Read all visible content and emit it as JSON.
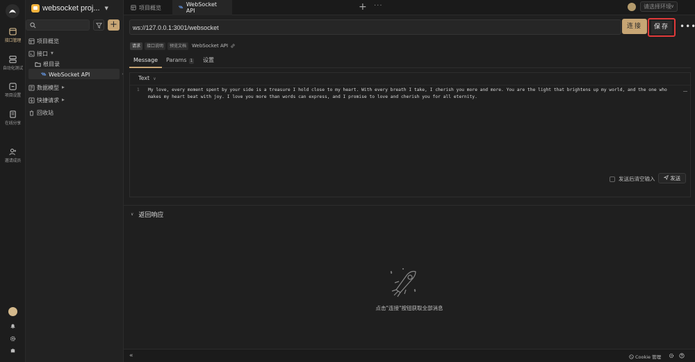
{
  "rail": {
    "items": [
      {
        "label": "接口管理",
        "icon": "api-management-icon",
        "active": true
      },
      {
        "label": "自动化测试",
        "icon": "automation-test-icon"
      },
      {
        "label": "项目设置",
        "icon": "project-settings-icon"
      },
      {
        "label": "在线分享",
        "icon": "online-share-icon"
      },
      {
        "label": "邀请成员",
        "icon": "invite-member-icon"
      }
    ]
  },
  "project": {
    "name": "websocket proj..."
  },
  "search": {
    "value": "",
    "placeholder": ""
  },
  "tree": {
    "items": [
      {
        "label": "项目概览",
        "icon": "overview-icon"
      },
      {
        "label": "接口",
        "icon": "api-folder-icon"
      },
      {
        "label": "根目录",
        "icon": "folder-icon"
      },
      {
        "label": "WebSocket API",
        "icon": "websocket-icon",
        "selected": true
      },
      {
        "label": "数据模型",
        "icon": "data-model-icon"
      },
      {
        "label": "快捷请求",
        "icon": "quick-request-icon"
      },
      {
        "label": "回收站",
        "icon": "trash-icon"
      }
    ]
  },
  "tabs": [
    {
      "label": "项目概览",
      "icon": "overview-icon"
    },
    {
      "label": "WebSocket API",
      "icon": "websocket-icon",
      "active": true
    }
  ],
  "env": {
    "placeholder": "请选择环境"
  },
  "url": {
    "value": "ws://127.0.0.1:3001/websocket"
  },
  "actions": {
    "connect_label": "连接",
    "save_label": "保存",
    "more": "•••"
  },
  "doc_tags": {
    "items": [
      "请求",
      "接口说明",
      "预览文档"
    ],
    "title": "WebSocket API"
  },
  "subtabs": [
    {
      "label": "Message",
      "active": true
    },
    {
      "label": "Params",
      "count": "1"
    },
    {
      "label": "设置"
    }
  ],
  "editor": {
    "mode": "Text",
    "line_number": "1",
    "content": "My love, every moment spent by your side is a treasure I hold close to my heart. With every breath I take, I cherish you more and more. You are the light that brightens up my world, and the one who makes my heart beat with joy. I love you more than words can express, and I promise to love and cherish you for all eternity."
  },
  "send": {
    "clear_label": "发送后清空输入",
    "send_label": "发送"
  },
  "response": {
    "title": "返回响应",
    "empty_text": "点击\"连接\"按钮获取全部消息"
  },
  "bottom": {
    "cookie_label": "Cookie 管理"
  },
  "colors": {
    "accent": "#c7a574",
    "highlight_border": "#e23a3a",
    "background": "#1f1f1f"
  }
}
